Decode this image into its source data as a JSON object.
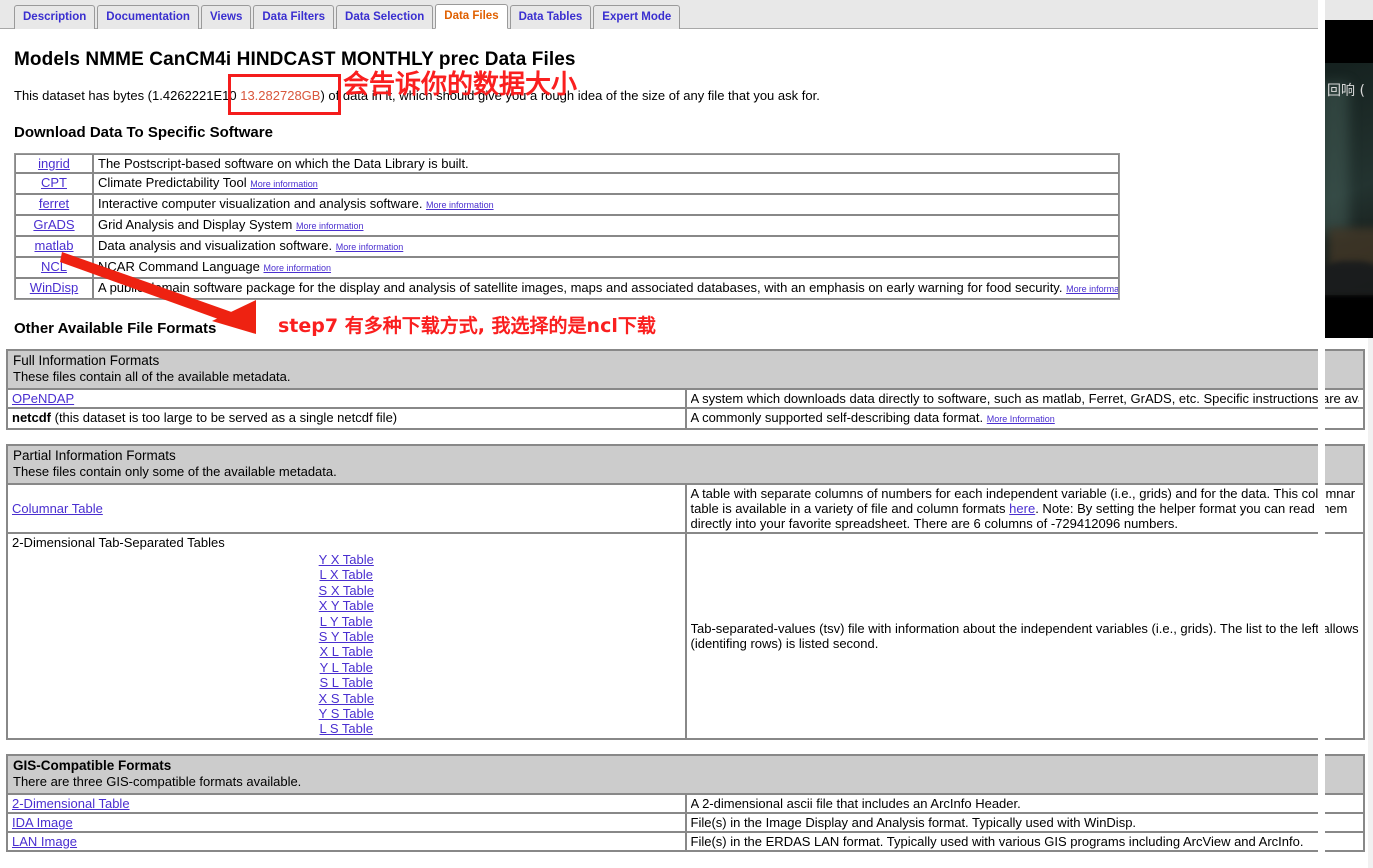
{
  "tabs": [
    {
      "label": "Description",
      "active": false
    },
    {
      "label": "Documentation",
      "active": false
    },
    {
      "label": "Views",
      "active": false
    },
    {
      "label": "Data Filters",
      "active": false
    },
    {
      "label": "Data Selection",
      "active": false
    },
    {
      "label": "Data Files",
      "active": true
    },
    {
      "label": "Data Tables",
      "active": false
    },
    {
      "label": "Expert Mode",
      "active": false
    }
  ],
  "page": {
    "title": "Models NMME CanCM4i HINDCAST MONTHLY prec Data Files",
    "intro_before": "This dataset has bytes (1.4262221E10 ",
    "intro_size": "13.282728GB",
    "intro_after": ") of data in it, which should give you a rough idea of the size of any file that you ask for.",
    "section_download": "Download Data To Specific Software",
    "section_other": "Other Available File Formats"
  },
  "software_table": {
    "more_info_label": "More information",
    "rows": [
      {
        "name": "ingrid",
        "desc": "The Postscript-based software on which the Data Library is built.",
        "more": false
      },
      {
        "name": "CPT",
        "desc": "Climate Predictability Tool ",
        "more": true
      },
      {
        "name": "ferret",
        "desc": "Interactive computer visualization and analysis software. ",
        "more": true
      },
      {
        "name": "GrADS",
        "desc": "Grid Analysis and Display System ",
        "more": true
      },
      {
        "name": "matlab",
        "desc": "Data analysis and visualization software. ",
        "more": true
      },
      {
        "name": "NCL",
        "desc": "NCAR Command Language ",
        "more": true
      },
      {
        "name": "WinDisp",
        "desc": "A public domain software package for the display and analysis of satellite images, maps and associated databases, with an emphasis on early warning for food security. ",
        "more": true
      }
    ]
  },
  "full_information": {
    "group_title": "Full Information Formats",
    "group_sub": "These files contain all of the available metadata.",
    "rows": [
      {
        "name": "OPeNDAP",
        "name_is_link": true,
        "desc": "A system which downloads data directly to software, such as matlab, Ferret, GrADS, etc. Specific instructions are available in the table above. Note: OPeNDAP was formerly known as DODS (Distributed Oceanographic Data System).",
        "more": false
      },
      {
        "name": "netcdf",
        "name_is_link": false,
        "name_suffix": " (this dataset is too large to be served as a single netcdf file)",
        "desc": "A commonly supported self-describing data format. ",
        "more": true,
        "more_label": "More Information"
      }
    ]
  },
  "partial_information": {
    "group_title": "Partial Information Formats",
    "group_sub": "These files contain only some of the available metadata.",
    "columnar": {
      "name": "Columnar Table",
      "desc_part1": "A table with separate columns of numbers for each independent variable (i.e., grids) and for the data. This columnar table is available in a variety of file and column formats ",
      "here_label": "here",
      "desc_part2": ". Note: By setting the helper format you can read them directly into your favorite spreadsheet. There are 6 columns of -729412096 numbers."
    },
    "tsv": {
      "name": "2-Dimensional Tab-Separated Tables",
      "links": [
        "Y X Table",
        "L X Table",
        "S X Table",
        "X Y Table",
        "L Y Table",
        "S Y Table",
        "X L Table",
        "Y L Table",
        "S L Table",
        "X S Table",
        "Y S Table",
        "L S Table"
      ],
      "desc_line1": "Tab-separated-values (tsv) file with information about the independent variables (i.e., grids). The list to the left allows you to specify the format of the table. Note: The variable running across the top of the table (identifing columns) is listed first and the variable running down the side of the table",
      "desc_line2": "(identifing rows) is listed second."
    }
  },
  "gis": {
    "group_title": "GIS-Compatible Formats",
    "group_sub": "There are three GIS-compatible formats available.",
    "rows": [
      {
        "name": "2-Dimensional Table",
        "desc": "A 2-dimensional ascii file that includes an ArcInfo Header."
      },
      {
        "name": "IDA Image",
        "desc": "File(s) in the Image Display and Analysis format. Typically used with WinDisp."
      },
      {
        "name": "LAN Image",
        "desc": "File(s) in the ERDAS LAN format. Typically used with various GIS programs including ArcView and ArcInfo."
      }
    ]
  },
  "annotations": {
    "size_note": "会告诉你的数据大小",
    "step_note": "step7 有多种下载方式, 我选择的是ncl下载"
  },
  "overlay": {
    "label": "回响 ("
  }
}
